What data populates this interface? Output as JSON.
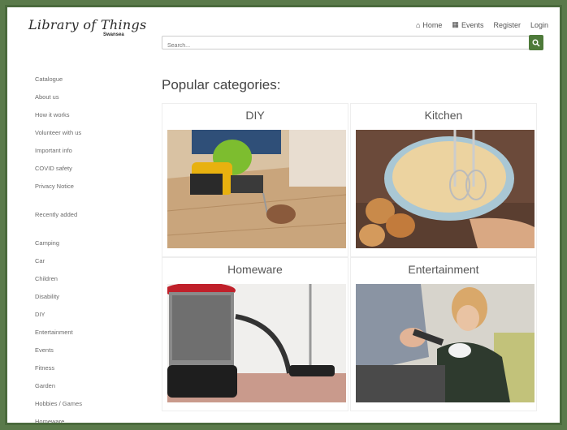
{
  "header": {
    "logo_main": "Library of Things",
    "logo_sub": "Swansea",
    "nav": [
      {
        "icon": "home-icon",
        "glyph": "⌂",
        "label": "Home"
      },
      {
        "icon": "calendar-icon",
        "glyph": "▦",
        "label": "Events"
      },
      {
        "icon": "",
        "glyph": "",
        "label": "Register"
      },
      {
        "icon": "",
        "glyph": "",
        "label": "Login"
      }
    ]
  },
  "search": {
    "placeholder": "Search...",
    "button_icon": "search-icon"
  },
  "sidebar": {
    "pages": [
      "Catalogue",
      "About us",
      "How it works",
      "Volunteer with us",
      "Important info",
      "COVID safety",
      "Privacy Notice"
    ],
    "recent": "Recently added",
    "categories": [
      "Camping",
      "Car",
      "Children",
      "Disability",
      "DIY",
      "Entertainment",
      "Events",
      "Fitness",
      "Garden",
      "Hobbies / Games",
      "Homeware"
    ]
  },
  "main": {
    "heading": "Popular categories:",
    "cards": [
      {
        "title": "DIY"
      },
      {
        "title": "Kitchen"
      },
      {
        "title": "Homeware"
      },
      {
        "title": "Entertainment"
      }
    ]
  },
  "colors": {
    "accent": "#4e7a3a",
    "frame": "#4a6a3c"
  }
}
